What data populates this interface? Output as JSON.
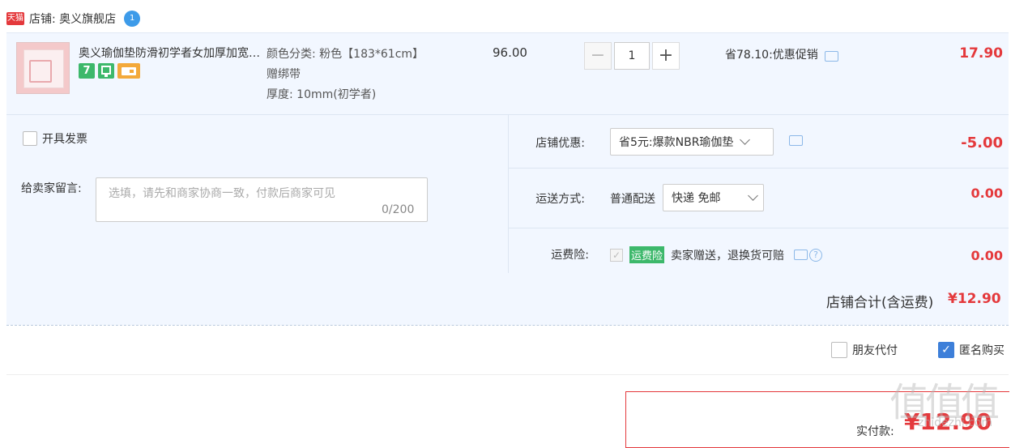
{
  "shop": {
    "badge": "天猫",
    "label": "店铺: 奥义旗舰店",
    "chat_badge": "1"
  },
  "item": {
    "title": "奥义瑜伽垫防滑初学者女加厚加宽加长",
    "services": [
      "7",
      "",
      ""
    ],
    "sku_lines": [
      "颜色分类: 粉色【183*61cm】",
      "赠绑带",
      "厚度: 10mm(初学者)"
    ],
    "unit_price": "96.00",
    "qty_minus": "−",
    "quantity": "1",
    "qty_plus": "+",
    "promo": "省78.10:优惠促销",
    "total": "17.90"
  },
  "options": {
    "invoice_label": "开具发票",
    "message_label": "给卖家留言:",
    "message_placeholder": "选填，请先和商家协商一致，付款后商家可见",
    "message_count": "0/200",
    "shop_discount_label": "店铺优惠:",
    "shop_discount_value": "省5元:爆款NBR瑜伽垫",
    "shop_discount_amount": "-5.00",
    "shipping_label": "运送方式:",
    "shipping_type": "普通配送",
    "shipping_value": "快递 免邮",
    "shipping_amount": "0.00",
    "insurance_label": "运费险:",
    "insurance_badge": "运费险",
    "insurance_text": "卖家赠送，退换货可赔",
    "insurance_amount": "0.00"
  },
  "summary": {
    "shop_total_label": "店铺合计(含运费)",
    "shop_total_value": "¥12.90",
    "friend_pay_label": "朋友代付",
    "anonymous_label": "匿名购买",
    "anonymous_checked": true,
    "final_label": "实付款:",
    "final_value": "¥12.90"
  },
  "watermark": {
    "text": "值值值",
    "url": "zhidezhi.com"
  },
  "colors": {
    "accent": "#e4393c",
    "panel": "#f2f7ff",
    "green": "#3db86b",
    "blue": "#3d7fd9"
  }
}
